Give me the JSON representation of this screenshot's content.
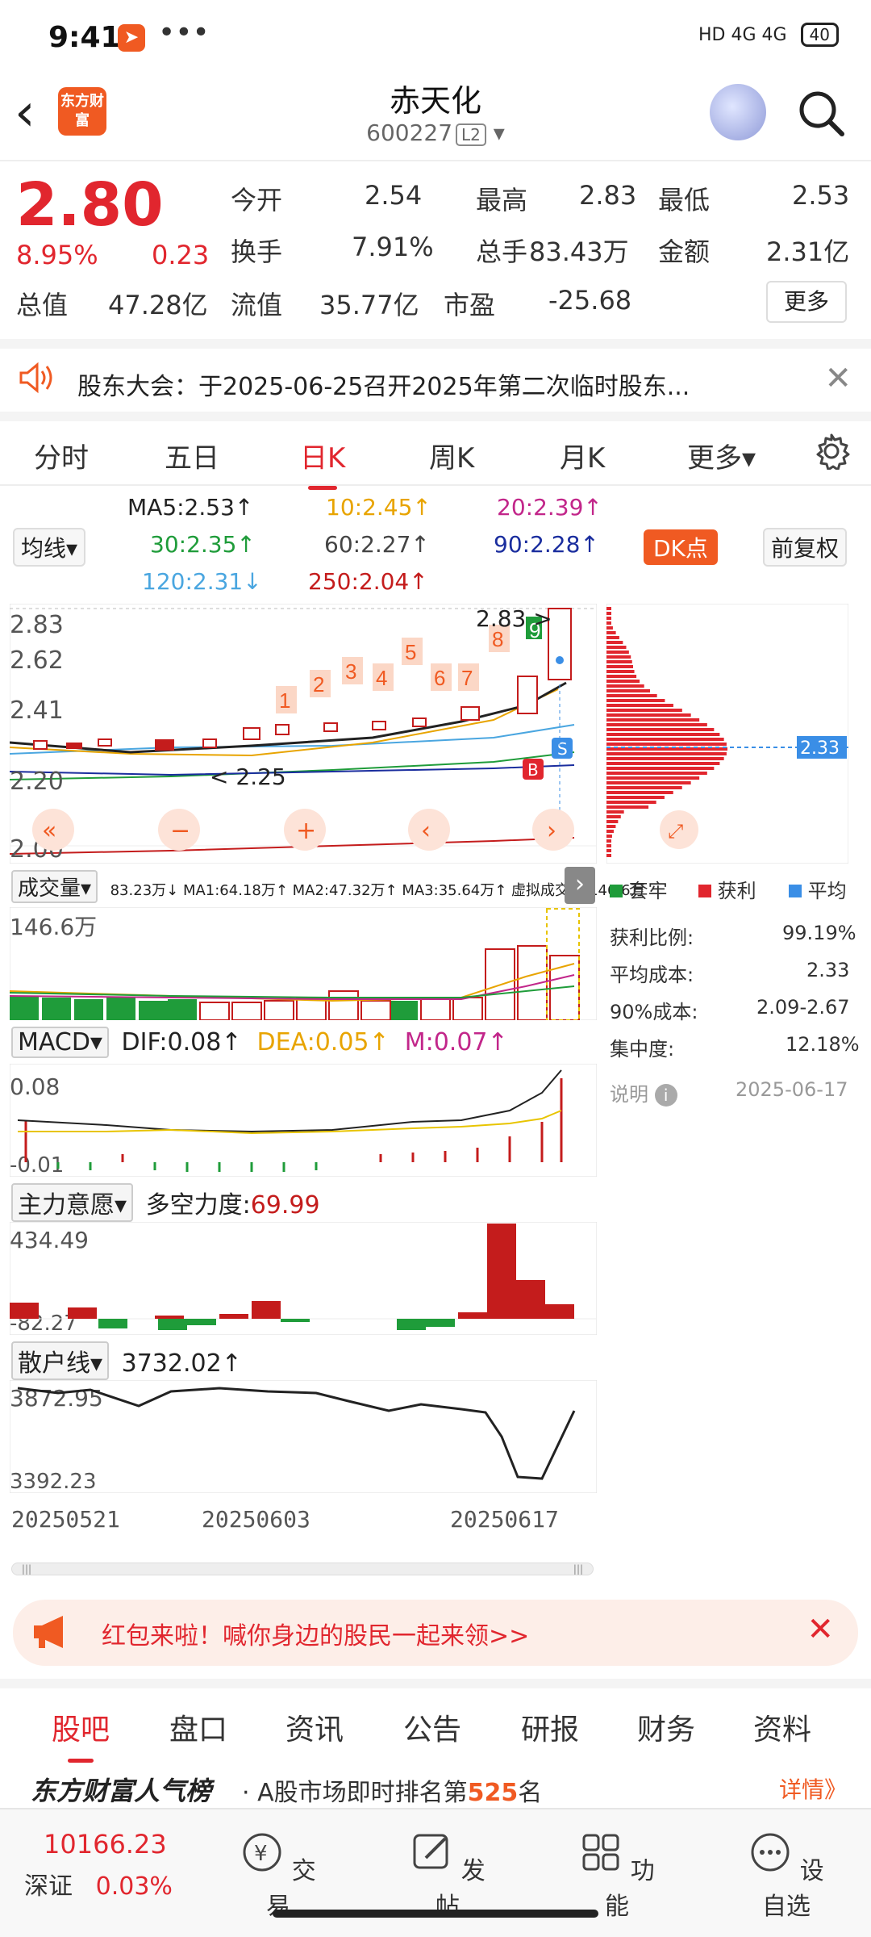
{
  "status": {
    "time": "9:41",
    "dots": "•••",
    "signal": "HD 4G 4G",
    "battery": "40"
  },
  "header": {
    "title": "赤天化",
    "code": "600227",
    "level": "L2",
    "logo": "东方财富"
  },
  "quote": {
    "price": "2.80",
    "pct": "8.95%",
    "chg": "0.23",
    "open_label": "今开",
    "open": "2.54",
    "high_label": "最高",
    "high": "2.83",
    "low_label": "最低",
    "low": "2.53",
    "turn_label": "换手",
    "turn": "7.91%",
    "vol_label": "总手",
    "vol": "83.43万",
    "amt_label": "金额",
    "amt": "2.31亿",
    "mcap_label": "总值",
    "mcap": "47.28亿",
    "float_label": "流值",
    "float": "35.77亿",
    "pe_label": "市盈",
    "pe": "-25.68",
    "more": "更多"
  },
  "notice": {
    "text": "股东大会：于2025-06-25召开2025年第二次临时股东..."
  },
  "tabs": [
    "分时",
    "五日",
    "日K",
    "周K",
    "月K",
    "更多▾"
  ],
  "ma": {
    "ma5": "MA5:2.53↑",
    "ma10": "10:2.45↑",
    "ma20": "20:2.39↑",
    "ma30": "30:2.35↑",
    "ma60": "60:2.27↑",
    "ma90": "90:2.28↑",
    "ma120": "120:2.31↓",
    "ma250": "250:2.04↑",
    "select": "均线▾",
    "dk": "DK点",
    "fq": "前复权"
  },
  "kline": {
    "y1": "2.83",
    "y2": "2.62",
    "y3": "2.41",
    "y4": "2.20",
    "y5": "2.00",
    "hi": "2.83",
    "lo": "2.25",
    "nums": [
      "1",
      "2",
      "3",
      "4",
      "5",
      "6",
      "7",
      "8",
      "9"
    ]
  },
  "chip": {
    "avg_tag": "2.33",
    "legend1": "套牢",
    "legend2": "获利",
    "legend3": "平均",
    "r1l": "获利比例:",
    "r1v": "99.19%",
    "r2l": "平均成本:",
    "r2v": "2.33",
    "r3l": "90%成本:",
    "r3v": "2.09-2.67",
    "r4l": "集中度:",
    "r4v": "12.18%",
    "note": "说明",
    "date": "2025-06-17"
  },
  "vol": {
    "select": "成交量▾",
    "line": "83.23万↓ MA1:64.18万↑ MA2:47.32万↑ MA3:35.64万↑ 虚拟成交量:146.6万",
    "max": "146.6万"
  },
  "macd": {
    "select": "MACD▾",
    "dif": "DIF:0.08↑",
    "dea": "DEA:0.05↑",
    "m": "M:0.07↑",
    "hi": "0.08",
    "lo": "-0.01"
  },
  "zl": {
    "select": "主力意愿▾",
    "lbl": "多空力度:",
    "val": "69.99",
    "hi": "434.49",
    "lo": "-82.27"
  },
  "sh": {
    "select": "散户线▾",
    "val": "3732.02↑",
    "hi": "3872.95",
    "lo": "3392.23"
  },
  "dates": [
    "20250521",
    "20250603",
    "20250617"
  ],
  "banner": {
    "text": "红包来啦！喊你身边的股民一起来领>>"
  },
  "bottabs": [
    "股吧",
    "盘口",
    "资讯",
    "公告",
    "研报",
    "财务",
    "资料"
  ],
  "rank": {
    "brand": "东方财富人气榜",
    "text": "· A股市场即时排名第",
    "num": "525",
    "unit": "名",
    "more": "详情》"
  },
  "nav": {
    "index_val": "10166.23",
    "index_name": "深证",
    "index_pct": "0.03%",
    "trade": "交易",
    "post": "发帖",
    "func": "功能",
    "fav": "设自选"
  }
}
